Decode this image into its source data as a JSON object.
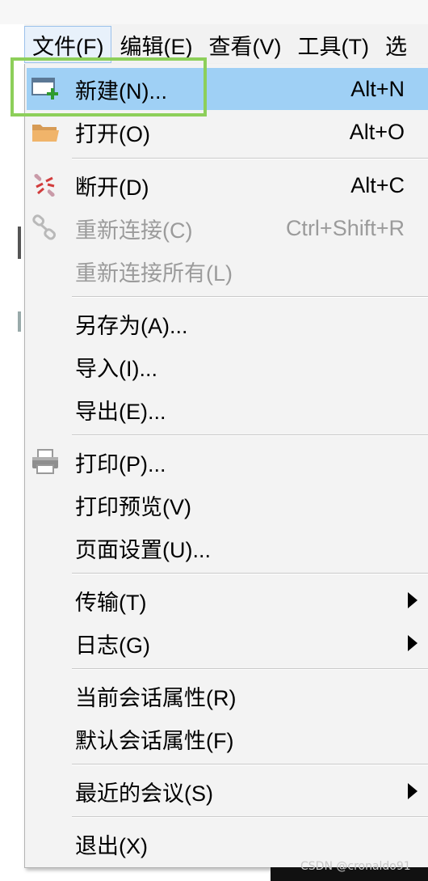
{
  "menubar": {
    "items": [
      {
        "label": "文件(F)",
        "active": true
      },
      {
        "label": "编辑(E)"
      },
      {
        "label": "查看(V)"
      },
      {
        "label": "工具(T)"
      },
      {
        "label": "选"
      }
    ]
  },
  "menu": {
    "new": {
      "label": "新建(N)...",
      "shortcut": "Alt+N",
      "icon": "new-session-icon"
    },
    "open": {
      "label": "打开(O)",
      "shortcut": "Alt+O",
      "icon": "folder-icon"
    },
    "disconnect": {
      "label": "断开(D)",
      "shortcut": "Alt+C",
      "icon": "disconnect-icon"
    },
    "reconnect": {
      "label": "重新连接(C)",
      "shortcut": "Ctrl+Shift+R",
      "icon": "reconnect-icon",
      "disabled": true
    },
    "reconnect_all": {
      "label": "重新连接所有(L)",
      "disabled": true
    },
    "save_as": {
      "label": "另存为(A)..."
    },
    "import": {
      "label": "导入(I)..."
    },
    "export": {
      "label": "导出(E)..."
    },
    "print": {
      "label": "打印(P)...",
      "icon": "printer-icon"
    },
    "print_preview": {
      "label": "打印预览(V)"
    },
    "page_setup": {
      "label": "页面设置(U)..."
    },
    "transfer": {
      "label": "传输(T)",
      "submenu": true
    },
    "log": {
      "label": "日志(G)",
      "submenu": true
    },
    "current_session_props": {
      "label": "当前会话属性(R)"
    },
    "default_session_props": {
      "label": "默认会话属性(F)"
    },
    "recent_sessions": {
      "label": "最近的会议(S)",
      "submenu": true
    },
    "exit": {
      "label": "退出(X)"
    }
  },
  "colors": {
    "highlight": "#9fd0f5",
    "focus_outline": "#8dcf5a",
    "disabled_text": "#9b9b9b"
  },
  "watermark": "CSDN @cronaldo91"
}
